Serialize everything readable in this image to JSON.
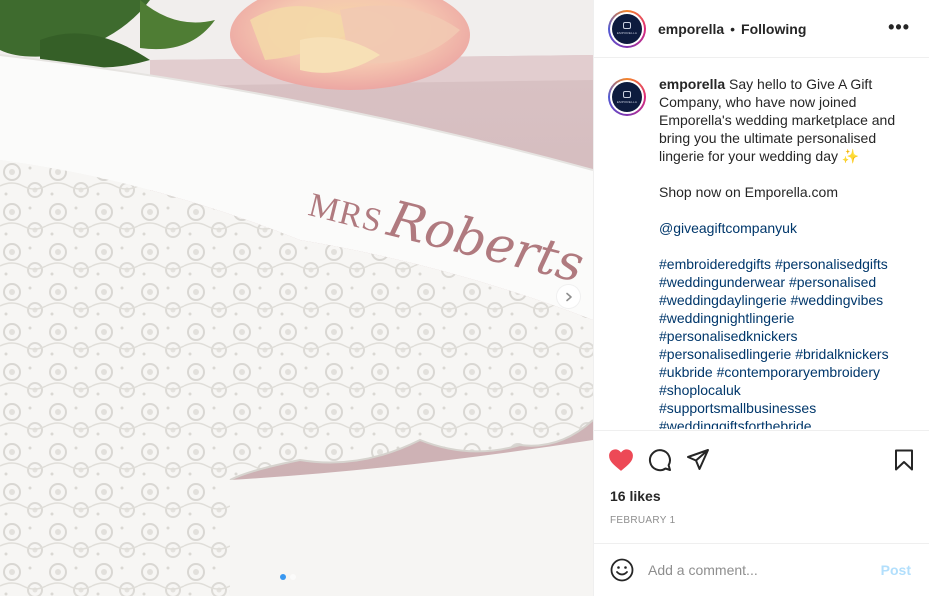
{
  "post": {
    "username": "emporella",
    "separator": "•",
    "follow_status": "Following",
    "more_label": "•••",
    "avatar_text": "EMPORELLA",
    "image_text_line1": "MRS",
    "image_text_line2": "Roberts",
    "carousel_total": 2,
    "carousel_active": 1
  },
  "caption": {
    "username": "emporella",
    "lines": [
      " Say hello to Give A Gift Company, who have now joined Emporella's wedding marketplace and bring you the ultimate personalised lingerie for your wedding day ✨"
    ],
    "shop_line": "Shop now on Emporella.com",
    "mention": "@giveagiftcompanyuk",
    "hashtags": [
      "#embroideredgifts #personalisedgifts",
      "#weddingunderwear #personalised",
      "#weddingdaylingerie #weddingvibes",
      "#weddingnightlingerie",
      "#personalisedknickers",
      "#personalisedlingerie #bridalknickers",
      "#ukbride #contemporaryembroidery",
      "#shoplocaluk",
      "#supportsmallbusinesses",
      "#weddinggiftsforthebride"
    ]
  },
  "engagement": {
    "likes": "16 likes",
    "date": "FEBRUARY 1",
    "liked": true,
    "like_color": "#ed4956"
  },
  "comment": {
    "placeholder": "Add a comment...",
    "post_label": "Post",
    "post_color": "#b2dffc"
  },
  "icons": {
    "like": "heart-icon",
    "comment": "comment-bubble-icon",
    "share": "paper-plane-icon",
    "save": "bookmark-icon",
    "emoji": "smiley-icon",
    "next": "chevron-right-icon"
  }
}
